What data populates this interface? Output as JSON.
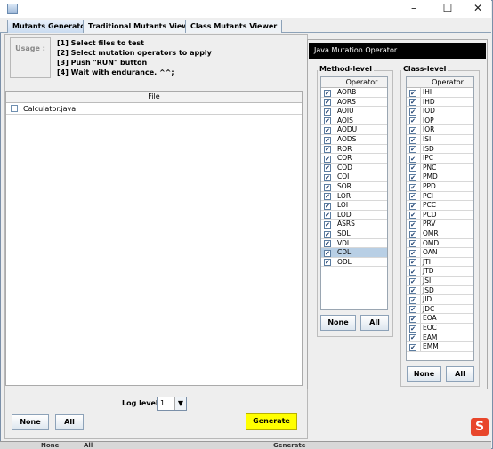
{
  "window": {
    "minimize": "–",
    "maximize": "☐",
    "close": "✕"
  },
  "tabs": [
    {
      "label": "Mutants Generator"
    },
    {
      "label": "Traditional Mutants Viewer"
    },
    {
      "label": "Class Mutants Viewer"
    }
  ],
  "usage": {
    "label": "Usage :",
    "lines": [
      "[1] Select files to test",
      "[2] Select mutation operators to apply",
      "[3] Push \"RUN\" button",
      "[4] Wait with endurance. ^^;"
    ]
  },
  "file_table": {
    "header": "File",
    "rows": [
      {
        "name": "Calculator.java",
        "checked": false
      }
    ]
  },
  "buttons": {
    "none": "None",
    "all": "All",
    "generate": "Generate"
  },
  "log_level": {
    "label": "Log level",
    "value": "1"
  },
  "operator_panel": {
    "title": "Java Mutation Operator",
    "method_level": {
      "title": "Method-level",
      "column": "Operator",
      "items": [
        "AORB",
        "AORS",
        "AOIU",
        "AOIS",
        "AODU",
        "AODS",
        "ROR",
        "COR",
        "COD",
        "COI",
        "SOR",
        "LOR",
        "LOI",
        "LOD",
        "ASRS",
        "SDL",
        "VDL",
        "CDL",
        "ODL"
      ],
      "selected": "CDL"
    },
    "class_level": {
      "title": "Class-level",
      "column": "Operator",
      "items": [
        "IHI",
        "IHD",
        "IOD",
        "IOP",
        "IOR",
        "ISI",
        "ISD",
        "IPC",
        "PNC",
        "PMD",
        "PPD",
        "PCI",
        "PCC",
        "PCD",
        "PRV",
        "OMR",
        "OMD",
        "OAN",
        "JTI",
        "JTD",
        "JSI",
        "JSD",
        "JID",
        "JDC",
        "EOA",
        "EOC",
        "EAM",
        "EMM"
      ]
    }
  },
  "colors": {
    "generate": "#ffff00",
    "selected_row": "#b8cfe5",
    "header_bg": "#000000"
  },
  "ghost_bottom": {
    "none": "None",
    "all": "All",
    "generate": "Generate"
  },
  "logo_letter": "S"
}
